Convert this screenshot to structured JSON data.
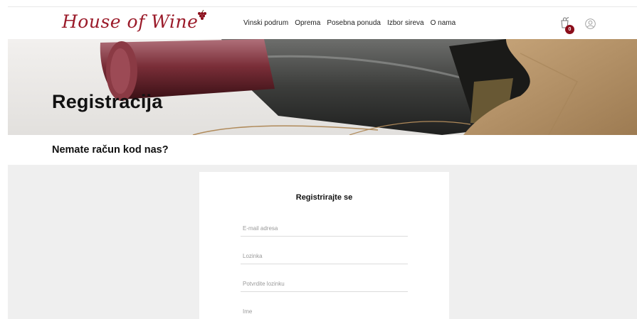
{
  "header": {
    "logo": "House of Wine",
    "nav": [
      "Vinski podrum",
      "Oprema",
      "Posebna ponuda",
      "Izbor sireva",
      "O nama"
    ],
    "cart_count": "0",
    "cart_icon": "cart-icon",
    "user_icon": "user-icon"
  },
  "hero": {
    "title": "Registracija"
  },
  "subtitle": "Nemate račun kod nas?",
  "form": {
    "title": "Registrirajte se",
    "email_placeholder": "E-mail adresa",
    "password_placeholder": "Lozinka",
    "confirm_placeholder": "Potvrdite lozinku",
    "name_placeholder": "Ime"
  },
  "colors": {
    "brand": "#9b1b2a",
    "badge": "#8b0d1a",
    "band": "#efefef"
  }
}
